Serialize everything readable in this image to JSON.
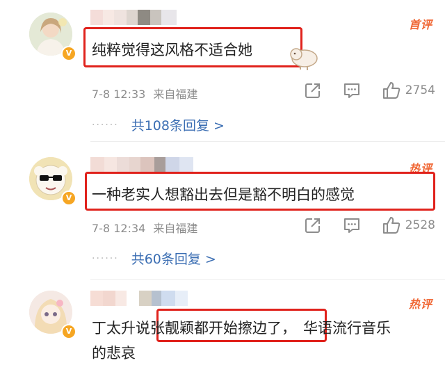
{
  "comments": [
    {
      "tag": "首评",
      "text": "纯粹觉得这风格不适合她",
      "time": "7-8 12:33",
      "location": "来自福建",
      "likes": "2754",
      "replies": "共108条回复 >"
    },
    {
      "tag": "热评",
      "text": "一种老实人想豁出去但是豁不明白的感觉",
      "time": "7-8 12:34",
      "location": "来自福建",
      "likes": "2528",
      "replies": "共60条回复 >"
    },
    {
      "tag": "热评",
      "text_before": "丁太升说",
      "text_highlight": "张靓颖都开始擦边了，",
      "text_after": "华语流行音乐",
      "text_line2": "的悲哀"
    }
  ],
  "badge": "V",
  "icons": [
    "share-icon",
    "comment-icon",
    "like-icon"
  ]
}
